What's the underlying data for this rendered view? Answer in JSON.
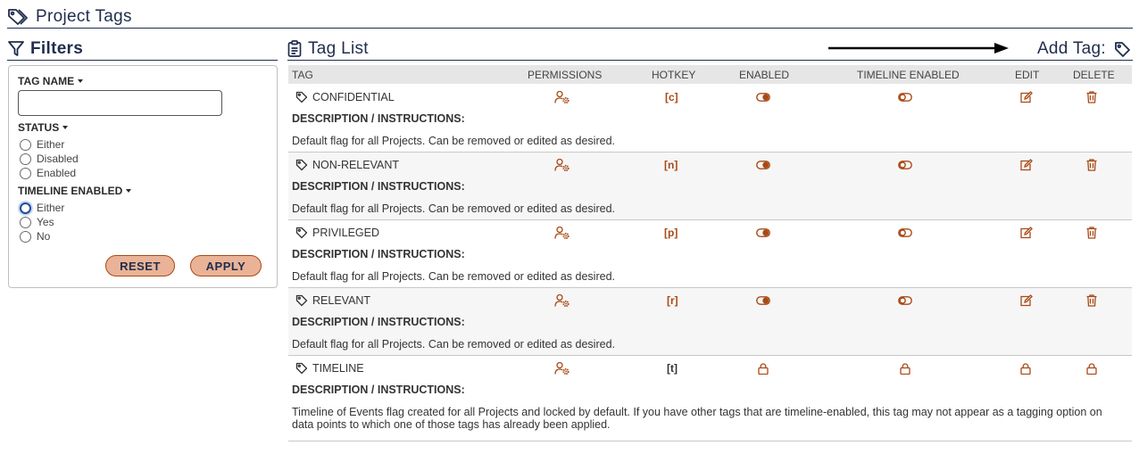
{
  "page": {
    "title": "Project Tags"
  },
  "filters": {
    "title": "Filters",
    "tag_name": {
      "label": "TAG NAME",
      "value": "",
      "placeholder": ""
    },
    "status": {
      "label": "STATUS",
      "options": [
        "Either",
        "Disabled",
        "Enabled"
      ]
    },
    "timeline_enabled": {
      "label": "TIMELINE ENABLED",
      "options": [
        "Either",
        "Yes",
        "No"
      ]
    },
    "reset_label": "RESET",
    "apply_label": "APPLY"
  },
  "tag_list": {
    "title": "Tag List",
    "add_tag_label": "Add Tag:",
    "columns": {
      "tag": "TAG",
      "permissions": "PERMISSIONS",
      "hotkey": "HOTKEY",
      "enabled": "ENABLED",
      "timeline_enabled": "TIMELINE ENABLED",
      "edit": "EDIT",
      "delete": "DELETE"
    },
    "description_label": "DESCRIPTION / INSTRUCTIONS:",
    "rows": [
      {
        "name": "CONFIDENTIAL",
        "hotkey": "[c]",
        "enabled": true,
        "timeline_enabled": false,
        "locked": false,
        "description": "Default flag for all Projects. Can be removed or edited as desired."
      },
      {
        "name": "NON-RELEVANT",
        "hotkey": "[n]",
        "enabled": true,
        "timeline_enabled": false,
        "locked": false,
        "description": "Default flag for all Projects. Can be removed or edited as desired."
      },
      {
        "name": "PRIVILEGED",
        "hotkey": "[p]",
        "enabled": true,
        "timeline_enabled": false,
        "locked": false,
        "description": "Default flag for all Projects. Can be removed or edited as desired."
      },
      {
        "name": "RELEVANT",
        "hotkey": "[r]",
        "enabled": true,
        "timeline_enabled": false,
        "locked": false,
        "description": "Default flag for all Projects. Can be removed or edited as desired."
      },
      {
        "name": "TIMELINE",
        "hotkey": "[t]",
        "enabled": true,
        "timeline_enabled": true,
        "locked": true,
        "description": "Timeline of Events flag created for all Projects and locked by default. If you have other tags that are timeline-enabled, this tag may not appear as a tagging option on data points to which one of those tags has already been applied."
      }
    ]
  },
  "colors": {
    "navy": "#1f2d4d",
    "rust": "#a84a16",
    "button_fill": "#eab397",
    "header_bg": "#e6e6e6"
  },
  "icons": {
    "page": "tags-icon",
    "filters": "filter-icon",
    "tag_list": "clipboard-list-icon",
    "add_tag": "tag-icon",
    "permissions": "user-gear-icon",
    "enabled_on": "toggle-on-icon",
    "timeline_off": "toggle-off-icon",
    "edit": "edit-icon",
    "delete": "trash-icon",
    "locked": "lock-icon"
  }
}
